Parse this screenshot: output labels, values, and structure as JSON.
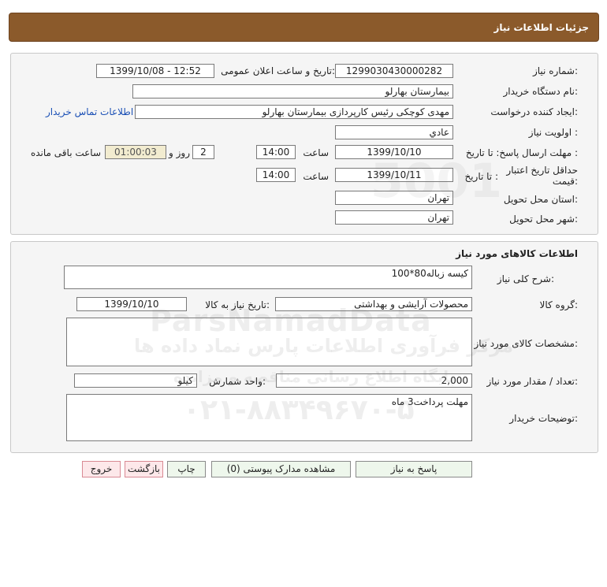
{
  "header": {
    "title": "جزئیات اطلاعات نیاز"
  },
  "info": {
    "need_number_label": "شماره نیاز:",
    "need_number": "1299030430000282",
    "announce_label": "تاریخ و ساعت اعلان عمومی:",
    "announce_value": "1399/10/08 - 12:52",
    "buyer_org_label": "نام دستگاه خریدار:",
    "buyer_org": "بیمارستان بهارلو",
    "requester_label": "ایجاد کننده درخواست:",
    "requester": "مهدی کوچکی  رئیس کارپردازی بیمارستان بهارلو",
    "contact_link": "اطلاعات تماس خریدار",
    "priority_label": "اولویت نیاز :",
    "priority": "عادي",
    "deadline_label": "مهلت ارسال پاسخ: تا تاریخ :",
    "deadline_date": "1399/10/10",
    "time_label": "ساعت",
    "deadline_time": "14:00",
    "days_value": "2",
    "days_label": "روز و",
    "remaining_time": "01:00:03",
    "remaining_label": "ساعت باقی مانده",
    "validity_label": "حداقل تاریخ اعتبار قیمت:",
    "validity_to_label": "تا تاریخ :",
    "validity_date": "1399/10/11",
    "validity_time": "14:00",
    "province_label": "استان محل تحویل:",
    "province": "تهران",
    "city_label": "شهر محل تحویل:",
    "city": "تهران"
  },
  "goods": {
    "section_title": "اطلاعات کالاهای مورد نیاز",
    "summary_label": "شرح کلی نیاز:",
    "summary": "کیسه زباله80*100",
    "group_label": "گروه کالا:",
    "group": "محصولات آرایشی و بهداشتی",
    "need_date_label": "تاریخ نیاز به کالا:",
    "need_date": "1399/10/10",
    "specs_label": "مشخصات کالای مورد نیاز:",
    "specs": "",
    "qty_label": "تعداد / مقدار مورد نیاز:",
    "qty": "2,000",
    "unit_label": "واحد شمارش:",
    "unit": "کیلو",
    "buyer_notes_label": "توضیحات خریدار:",
    "buyer_notes": "مهلت پرداخت3 ماه"
  },
  "buttons": {
    "reply": "پاسخ به نیاز",
    "attachments": "مشاهده مدارک پیوستی (0)",
    "print": "چاپ",
    "back": "بازگشت",
    "exit": "خروج"
  },
  "watermark": {
    "brand": "ParsNamadData",
    "line1": "مرکز فرآوری اطلاعات پارس نماد داده ها",
    "line2": "پایگاه اطلاع رسانی مناقصه و مزایده",
    "phone": "۰۲۱-۸۸۳۴۹۶۷۰-۵"
  }
}
